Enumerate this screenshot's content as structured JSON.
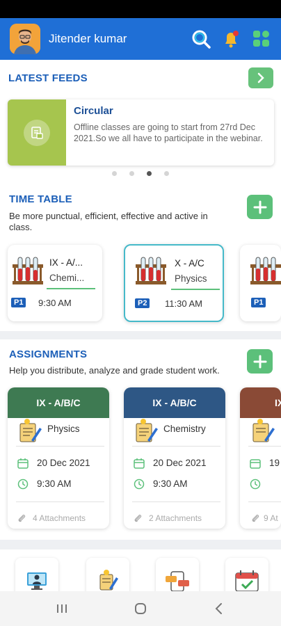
{
  "header": {
    "user_name": "Jitender kumar",
    "icons": [
      "search-icon",
      "bell-icon",
      "apps-icon"
    ],
    "notification_badge_color": "#e53935",
    "header_color": "#1f6fd6"
  },
  "feeds": {
    "title": "LATEST FEEDS",
    "card": {
      "heading": "Circular",
      "body": "Offline classes are going to start from 27rd Dec 2021.So we all have to participate in the webinar.",
      "icon": "document-icon",
      "image_color": "#a6c54e"
    },
    "pagination": {
      "total": 4,
      "active_index": 2
    }
  },
  "timetable": {
    "title": "TIME TABLE",
    "description": "Be more punctual, efficient, effective and active in class.",
    "cards": [
      {
        "class_name": "IX - A/...",
        "subject": "Chemi...",
        "period": "P1",
        "time": "9:30 AM",
        "selected": false
      },
      {
        "class_name": "X - A/C",
        "subject": "Physics",
        "period": "P2",
        "time": "11:30 AM",
        "selected": true
      },
      {
        "class_name": "",
        "subject": "",
        "period": "P1",
        "time": "",
        "selected": false
      }
    ]
  },
  "assignments": {
    "title": "ASSIGNMENTS",
    "description": "Help you distribute, analyze and grade student work.",
    "cards": [
      {
        "class_name": "IX - A/B/C",
        "subject": "Physics",
        "date": "20 Dec 2021",
        "time": "9:30 AM",
        "attachments": "4 Attachments",
        "color": "#3e7a52"
      },
      {
        "class_name": "IX - A/B/C",
        "subject": "Chemistry",
        "date": "20 Dec 2021",
        "time": "9:30 AM",
        "attachments": "2 Attachments",
        "color": "#2e5785"
      },
      {
        "class_name": "IX",
        "subject": "",
        "date": "19 I",
        "time": "",
        "attachments": "9 At",
        "color": "#8a4a36"
      }
    ]
  },
  "quick_links": {
    "icons": [
      "online-class-icon",
      "assignment-icon",
      "chat-icon",
      "calendar-icon"
    ]
  },
  "system_nav": {
    "icons": [
      "recent-apps-icon",
      "home-icon",
      "back-icon"
    ]
  }
}
